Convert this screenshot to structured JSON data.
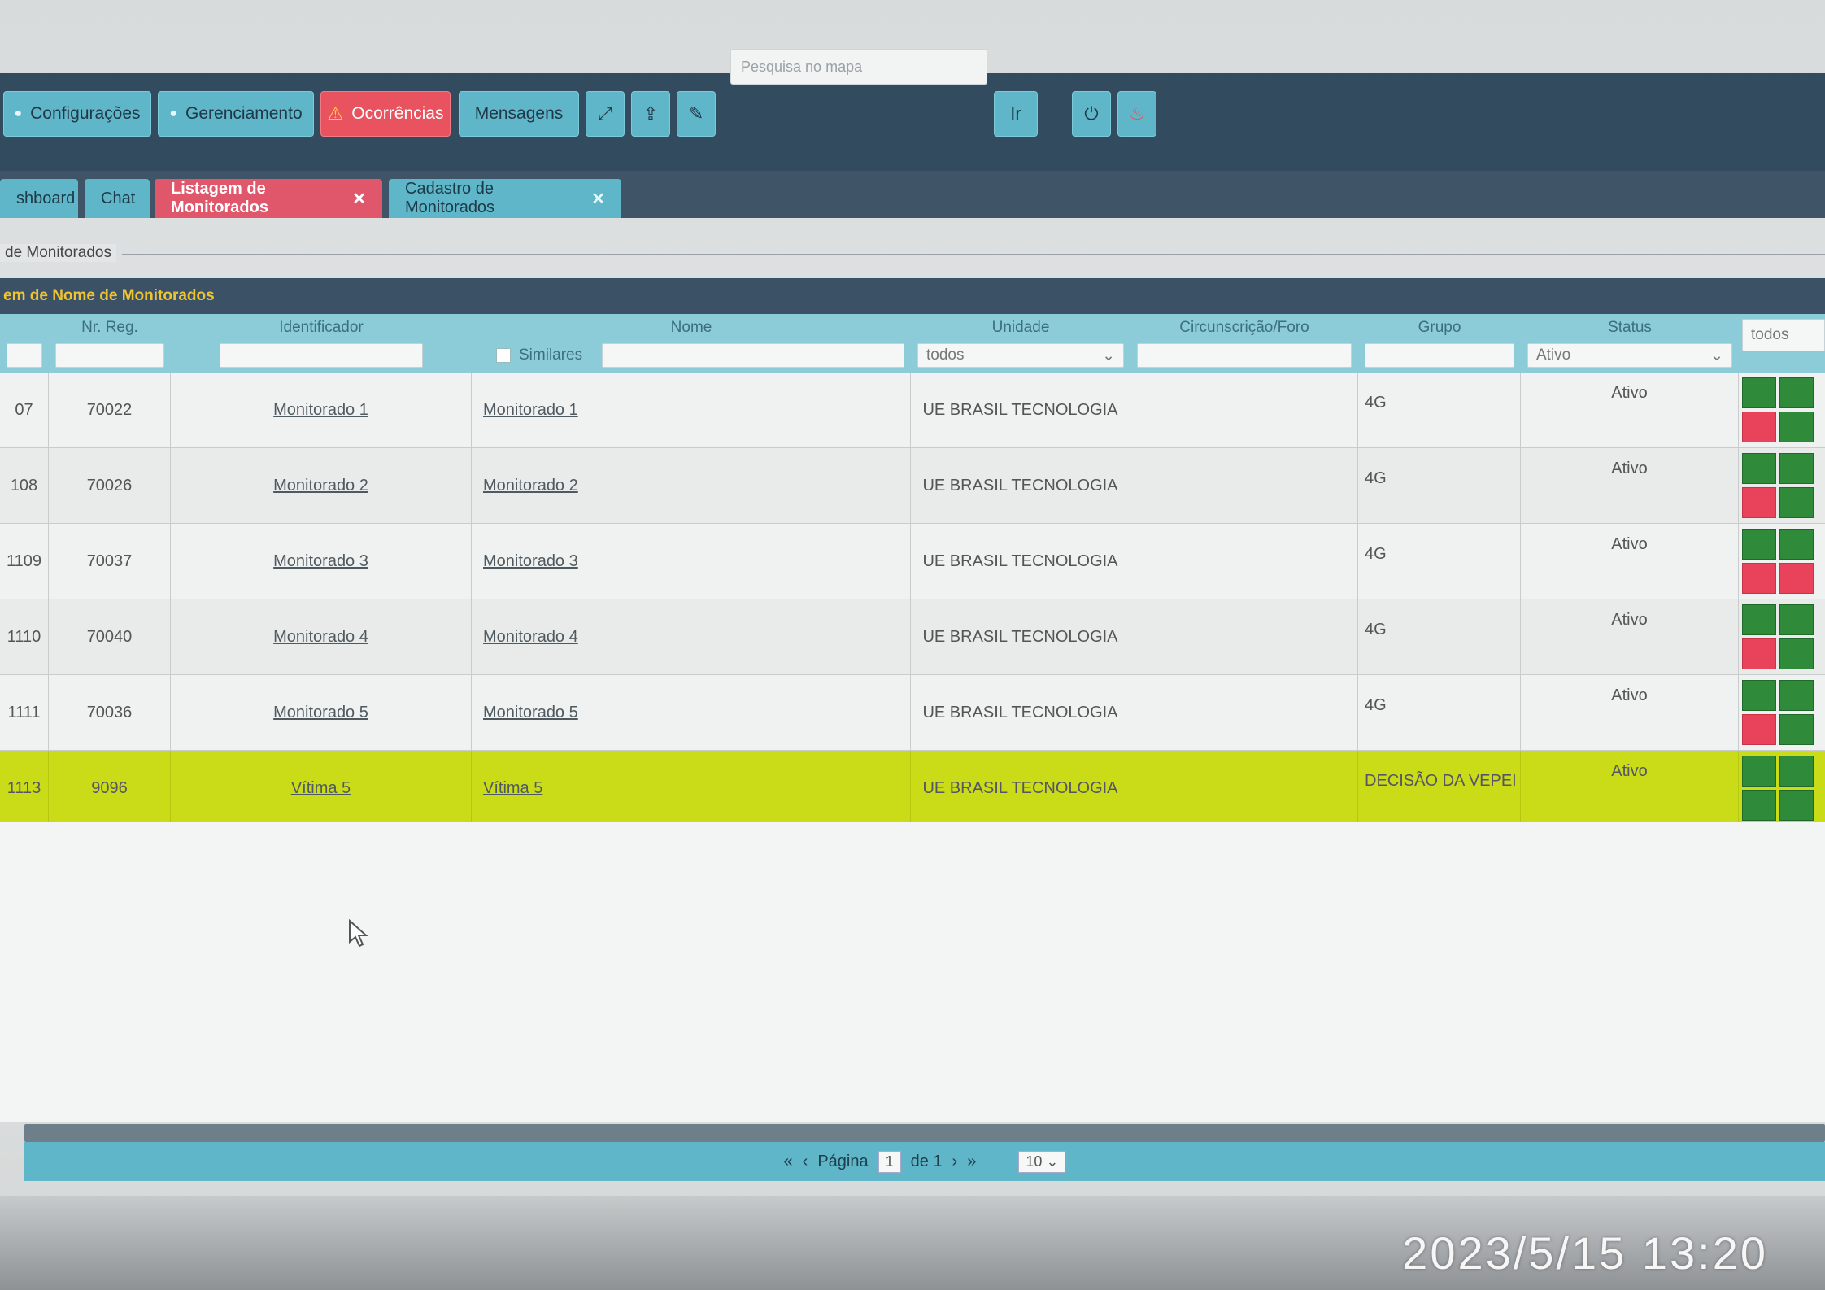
{
  "toolbar": {
    "buttons": [
      {
        "label": "Configurações"
      },
      {
        "label": "Gerenciamento"
      },
      {
        "label": "Ocorrências"
      },
      {
        "label": "Mensagens"
      }
    ],
    "map_search_placeholder": "Pesquisa no mapa",
    "go_label": "Ir",
    "icons": [
      "expand-icon",
      "share-icon",
      "edit-icon",
      "power-icon",
      "flame-icon"
    ]
  },
  "tabs": [
    {
      "label": "shboard"
    },
    {
      "label": "Chat"
    },
    {
      "label": "Listagem de Monitorados",
      "active": true
    },
    {
      "label": "Cadastro de Monitorados"
    }
  ],
  "section_title": "de Monitorados",
  "panel_title": "em de Nome de Monitorados",
  "columns": {
    "nr_reg": "Nr. Reg.",
    "identificador": "Identificador",
    "nome": "Nome",
    "similares": "Similares",
    "unidade": "Unidade",
    "circunscricao": "Circunscrição/Foro",
    "grupo": "Grupo",
    "status": "Status"
  },
  "filters": {
    "unidade": "todos",
    "status": "Ativo",
    "extra": "todos"
  },
  "rows": [
    {
      "id": "07",
      "nr_reg": "70022",
      "identificador": "Monitorado 1",
      "nome": "Monitorado 1",
      "unidade": "UE BRASIL TECNOLOGIA",
      "grupo": "4G",
      "status": "Ativo"
    },
    {
      "id": "108",
      "nr_reg": "70026",
      "identificador": "Monitorado 2",
      "nome": "Monitorado 2",
      "unidade": "UE BRASIL TECNOLOGIA",
      "grupo": "4G",
      "status": "Ativo"
    },
    {
      "id": "1109",
      "nr_reg": "70037",
      "identificador": "Monitorado 3",
      "nome": "Monitorado 3",
      "unidade": "UE BRASIL TECNOLOGIA",
      "grupo": "4G",
      "status": "Ativo"
    },
    {
      "id": "1110",
      "nr_reg": "70040",
      "identificador": "Monitorado 4",
      "nome": "Monitorado 4",
      "unidade": "UE BRASIL TECNOLOGIA",
      "grupo": "4G",
      "status": "Ativo"
    },
    {
      "id": "1111",
      "nr_reg": "70036",
      "identificador": "Monitorado 5",
      "nome": "Monitorado 5",
      "unidade": "UE BRASIL TECNOLOGIA",
      "grupo": "4G",
      "status": "Ativo"
    },
    {
      "id": "1113",
      "nr_reg": "9096",
      "identificador": "Vítima 5",
      "nome": "Vítima 5",
      "unidade": "UE BRASIL TECNOLOGIA",
      "grupo": "DECISÃO DA VEPEI",
      "status": "Ativo",
      "highlight": true
    }
  ],
  "pagination": {
    "page_label": "Página",
    "page_value": "1",
    "of_label": "de 1",
    "per_page": "10"
  },
  "colors": {
    "toolbar_bg": "#334b5f",
    "accent": "#5fb6c8",
    "alert": "#e8535f",
    "highlight_row": "#c9dc17",
    "status_ok": "#2f8a3a",
    "status_alarm": "#e8435a"
  },
  "photo_timestamp": "2023/5/15  13:20"
}
